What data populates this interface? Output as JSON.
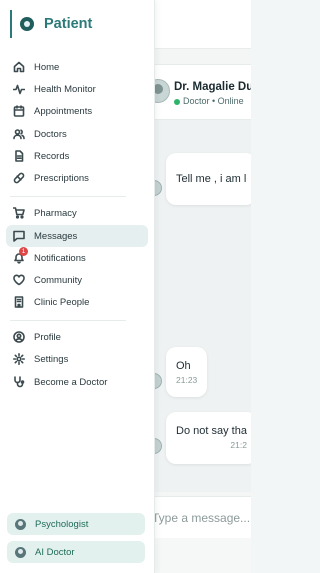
{
  "brand": {
    "title": "Patient",
    "accent": "#2b7a78"
  },
  "nav": {
    "main": [
      {
        "label": "Home",
        "icon": "home-icon"
      },
      {
        "label": "Health Monitor",
        "icon": "activity-icon"
      },
      {
        "label": "Appointments",
        "icon": "calendar-icon"
      },
      {
        "label": "Doctors",
        "icon": "users-icon"
      },
      {
        "label": "Records",
        "icon": "file-icon"
      },
      {
        "label": "Prescriptions",
        "icon": "pill-icon"
      }
    ],
    "secondary": [
      {
        "label": "Pharmacy",
        "icon": "cart-icon"
      },
      {
        "label": "Messages",
        "icon": "message-icon",
        "active": true
      },
      {
        "label": "Notifications",
        "icon": "bell-icon",
        "badge": "1"
      },
      {
        "label": "Community",
        "icon": "heart-icon"
      },
      {
        "label": "Clinic People",
        "icon": "building-icon"
      }
    ],
    "account": [
      {
        "label": "Profile",
        "icon": "user-circle-icon"
      },
      {
        "label": "Settings",
        "icon": "gear-icon"
      },
      {
        "label": "Become a Doctor",
        "icon": "stethoscope-icon"
      }
    ],
    "footer": [
      {
        "label": "Psychologist",
        "icon": "psychologist-avatar-icon"
      },
      {
        "label": "AI Doctor",
        "icon": "ai-doctor-avatar-icon"
      }
    ]
  },
  "chat": {
    "contact_name": "Dr. Magalie Du",
    "contact_status": "Doctor • Online",
    "messages": [
      {
        "text": "Tell me , i am l",
        "time": ""
      },
      {
        "text": "Oh",
        "time": "21:23"
      },
      {
        "text": "Do not say tha",
        "time": "21:2"
      }
    ],
    "input_placeholder": "Type a message..."
  },
  "colors": {
    "online": "#2fb36b",
    "badge": "#e04646",
    "active_bg": "#e6efef",
    "footer_btn_bg": "#e3f1ee"
  }
}
